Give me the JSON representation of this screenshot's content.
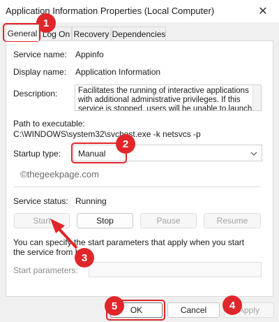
{
  "window": {
    "title": "Application Information Properties (Local Computer)"
  },
  "tabs": [
    {
      "label": "General"
    },
    {
      "label": "Log On"
    },
    {
      "label": "Recovery"
    },
    {
      "label": "Dependencies"
    }
  ],
  "fields": {
    "service_name_label": "Service name:",
    "service_name_value": "Appinfo",
    "display_name_label": "Display name:",
    "display_name_value": "Application Information",
    "description_label": "Description:",
    "description_value": "Facilitates the running of interactive applications with additional administrative privileges.  If this service is stopped, users will be unable to launch applications",
    "path_label": "Path to executable:",
    "path_value": "C:\\WINDOWS\\system32\\svchost.exe -k netsvcs -p",
    "startup_type_label": "Startup type:",
    "startup_type_value": "Manual",
    "service_status_label": "Service status:",
    "service_status_value": "Running"
  },
  "control_buttons": {
    "start": "Start",
    "stop": "Stop",
    "pause": "Pause",
    "resume": "Resume"
  },
  "hint_text": "You can specify the start parameters that apply when you start the service from here.",
  "start_params_label": "Start parameters:",
  "start_params_value": "",
  "footer": {
    "ok": "OK",
    "cancel": "Cancel",
    "apply": "Apply"
  },
  "watermark": "©thegeekpage.com",
  "annotations": [
    "1",
    "2",
    "3",
    "4",
    "5"
  ],
  "colors": {
    "annotation": "#e0262a"
  }
}
